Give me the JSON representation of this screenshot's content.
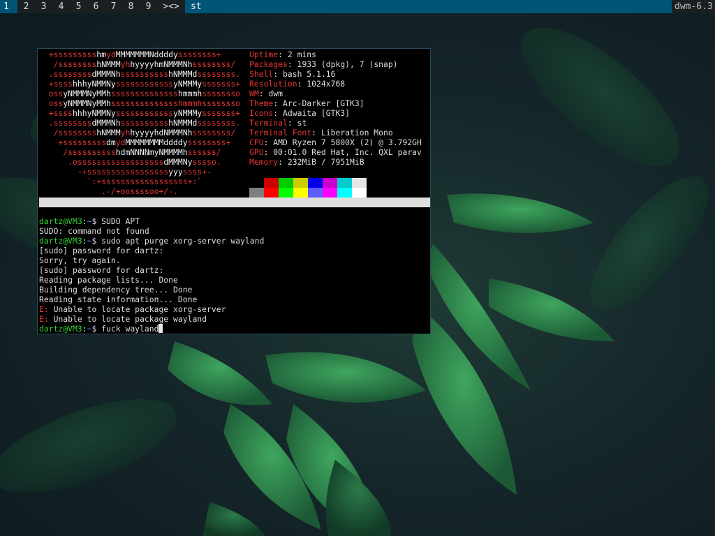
{
  "bar": {
    "tags": [
      "1",
      "2",
      "3",
      "4",
      "5",
      "6",
      "7",
      "8",
      "9"
    ],
    "active_tag": "1",
    "layout": "><>",
    "window_title": "st",
    "status": "dwm-6.3"
  },
  "colors": {
    "bar_bg": "#1a1f22",
    "bar_accent": "#005577",
    "prompt_user": "#35d135",
    "prompt_path": "#6d9cff",
    "logo": "#e63535"
  },
  "neofetch": {
    "logo": [
      [
        [
          "r",
          "  +sssssssss"
        ],
        [
          "w",
          "hm"
        ],
        [
          "r",
          "yd"
        ],
        [
          "w",
          "MMMMMMMNddddy"
        ],
        [
          "r",
          "ssssssss+"
        ]
      ],
      [
        [
          "r",
          "   /ssssssss"
        ],
        [
          "w",
          "hNMMM"
        ],
        [
          "r",
          "yh"
        ],
        [
          "w",
          "hyyyyhmNMMMNh"
        ],
        [
          "r",
          "ssssssss/"
        ]
      ],
      [
        [
          "r",
          "  .ssssssss"
        ],
        [
          "w",
          "dMMMNh"
        ],
        [
          "r",
          "ssssssssss"
        ],
        [
          "w",
          "hNMMMd"
        ],
        [
          "r",
          "ssssssss."
        ]
      ],
      [
        [
          "r",
          "  +ssss"
        ],
        [
          "w",
          "hhhyNMMNy"
        ],
        [
          "r",
          "ssssssssssss"
        ],
        [
          "w",
          "yNMMMy"
        ],
        [
          "r",
          "sssssss+"
        ]
      ],
      [
        [
          "r",
          "  oss"
        ],
        [
          "w",
          "yNMMMNyMMh"
        ],
        [
          "r",
          "ssssssssssssss"
        ],
        [
          "w",
          "hmmmh"
        ],
        [
          "r",
          "ssssssso"
        ]
      ],
      [
        [
          "r",
          "  oss"
        ],
        [
          "w",
          "yNMMMNyMMh"
        ],
        [
          "r",
          "sssssssssssssshmmmhssssssso"
        ]
      ],
      [
        [
          "r",
          "  +ssss"
        ],
        [
          "w",
          "hhhyNMMNy"
        ],
        [
          "r",
          "ssssssssssss"
        ],
        [
          "w",
          "yNMMMy"
        ],
        [
          "r",
          "sssssss+"
        ]
      ],
      [
        [
          "r",
          "  .ssssssss"
        ],
        [
          "w",
          "dMMMNh"
        ],
        [
          "r",
          "ssssssssss"
        ],
        [
          "w",
          "hNMMMd"
        ],
        [
          "r",
          "ssssssss."
        ]
      ],
      [
        [
          "r",
          "   /ssssssss"
        ],
        [
          "w",
          "hNMMM"
        ],
        [
          "r",
          "yh"
        ],
        [
          "w",
          "hyyyyhdNMMMNh"
        ],
        [
          "r",
          "ssssssss/"
        ]
      ],
      [
        [
          "r",
          "    +sssssssss"
        ],
        [
          "w",
          "dm"
        ],
        [
          "r",
          "yd"
        ],
        [
          "w",
          "MMMMMMMMddddy"
        ],
        [
          "r",
          "ssssssss+"
        ]
      ],
      [
        [
          "r",
          "     /ssssssssss"
        ],
        [
          "w",
          "hdmNNNNmyNMMMMh"
        ],
        [
          "r",
          "ssssss/"
        ]
      ],
      [
        [
          "r",
          "      .ossssssssssssssssss"
        ],
        [
          "w",
          "dMMMNy"
        ],
        [
          "r",
          "sssso."
        ]
      ],
      [
        [
          "r",
          "        -+sssssssssssssssss"
        ],
        [
          "w",
          "yyy"
        ],
        [
          "r",
          "ssss+-"
        ]
      ],
      [
        [
          "r",
          "          `:+ssssssssssssssssss+:`"
        ]
      ],
      [
        [
          "r",
          "             .-/+oossssoo+/-."
        ]
      ]
    ],
    "info": [
      {
        "key": "Uptime",
        "value": "2 mins"
      },
      {
        "key": "Packages",
        "value": "1933 (dpkg), 7 (snap)"
      },
      {
        "key": "Shell",
        "value": "bash 5.1.16"
      },
      {
        "key": "Resolution",
        "value": "1024x768"
      },
      {
        "key": "WM",
        "value": "dwm"
      },
      {
        "key": "Theme",
        "value": "Arc-Darker [GTK3]"
      },
      {
        "key": "Icons",
        "value": "Adwaita [GTK3]"
      },
      {
        "key": "Terminal",
        "value": "st"
      },
      {
        "key": "Terminal Font",
        "value": "Liberation Mono"
      },
      {
        "key": "CPU",
        "value": "AMD Ryzen 7 5800X (2) @ 3.792GH"
      },
      {
        "key": "GPU",
        "value": "00:01.0 Red Hat, Inc. QXL parav"
      },
      {
        "key": "Memory",
        "value": "232MiB / 7951MiB"
      }
    ],
    "palette_top": [
      "#000000",
      "#cc0000",
      "#00cc00",
      "#cccc00",
      "#0000ee",
      "#cc00cc",
      "#00cccc",
      "#e5e5e5"
    ],
    "palette_bottom": [
      "#7f7f7f",
      "#ff0000",
      "#00ff00",
      "#ffff00",
      "#5c5cff",
      "#ff00ff",
      "#00ffff",
      "#ffffff"
    ]
  },
  "console": [
    {
      "type": "cmd",
      "user": "dartz@VM3",
      "path": "~",
      "text": "SUDO APT"
    },
    {
      "type": "out",
      "text": "SUDO: command not found"
    },
    {
      "type": "cmd",
      "user": "dartz@VM3",
      "path": "~",
      "text": "sudo apt purge xorg-server wayland"
    },
    {
      "type": "out",
      "text": "[sudo] password for dartz:"
    },
    {
      "type": "out",
      "text": "Sorry, try again."
    },
    {
      "type": "out",
      "text": "[sudo] password for dartz:"
    },
    {
      "type": "out",
      "text": "Reading package lists... Done"
    },
    {
      "type": "out",
      "text": "Building dependency tree... Done"
    },
    {
      "type": "out",
      "text": "Reading state information... Done"
    },
    {
      "type": "err",
      "prefix": "E:",
      "text": " Unable to locate package xorg-server"
    },
    {
      "type": "err",
      "prefix": "E:",
      "text": " Unable to locate package wayland"
    },
    {
      "type": "cmd",
      "user": "dartz@VM3",
      "path": "~",
      "text": "fuck wayland",
      "cursor": true
    }
  ]
}
